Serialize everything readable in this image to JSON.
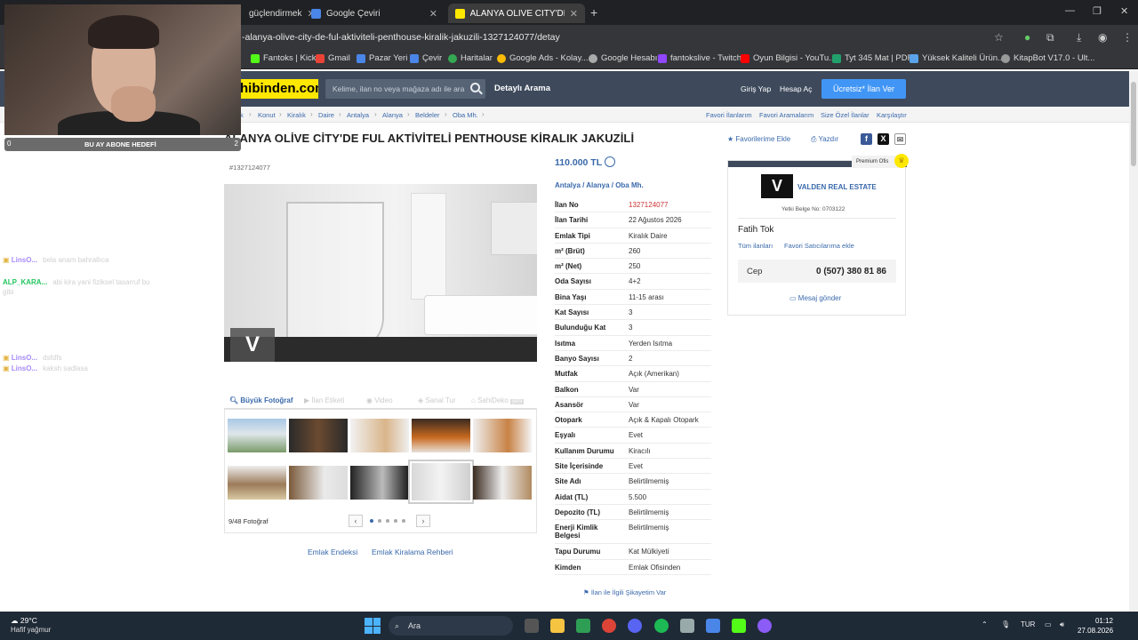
{
  "browser": {
    "tabs": [
      {
        "label": "güçlendirmek",
        "active": false
      },
      {
        "label": "Google Çeviri",
        "active": false
      },
      {
        "label": "ALANYA OLİVE CİTY'DE FUL AK",
        "active": true
      }
    ],
    "url": "-alanya-olive-city-de-ful-aktiviteli-penthouse-kiralik-jakuzili-1327124077/detay",
    "bookmarks": [
      "Fantoks | Kick",
      "Gmail",
      "Pazar Yeri",
      "Çevir",
      "Haritalar",
      "Google Ads - Kolay...",
      "Google Hesabı",
      "fantokslive - Twitch",
      "Oyun Bilgisi - YouTu...",
      "Tyt 345 Mat | PDF",
      "Yüksek Kaliteli Ürün...",
      "KitapBot V17.0 - Ult..."
    ]
  },
  "header": {
    "logo": "hibinden.com",
    "search_placeholder": "Kelime, ilan no veya mağaza adı ile ara",
    "detail_search": "Detaylı Arama",
    "login": "Giriş Yap",
    "register": "Hesap Aç",
    "cta": "Ücretsiz* İlan Ver"
  },
  "breadcrumb": {
    "items": [
      "k",
      "Konut",
      "Kiralık",
      "Daire",
      "Antalya",
      "Alanya",
      "Beldeler",
      "Oba Mh."
    ],
    "right": [
      "Favori İlanlarım",
      "Favori Aramalarım",
      "Size Özel İlanlar",
      "Karşılaştır"
    ]
  },
  "listing": {
    "title": "ALANYA OLİVE CİTY'DE FUL AKTİVİTELİ PENTHOUSE KİRALIK JAKUZİLİ",
    "fav_add": "Favorilerime Ekle",
    "print": "Yazdır",
    "id_tag": "#1327124077",
    "price": "110.000 TL",
    "location": [
      "Antalya",
      "Alanya",
      "Oba Mh."
    ],
    "details": [
      {
        "k": "İlan No",
        "v": "1327124077"
      },
      {
        "k": "İlan Tarihi",
        "v": "22 Ağustos 2026"
      },
      {
        "k": "Emlak Tipi",
        "v": "Kiralık Daire"
      },
      {
        "k": "m² (Brüt)",
        "v": "260"
      },
      {
        "k": "m² (Net)",
        "v": "250"
      },
      {
        "k": "Oda Sayısı",
        "v": "4+2"
      },
      {
        "k": "Bina Yaşı",
        "v": "11-15 arası"
      },
      {
        "k": "Kat Sayısı",
        "v": "3"
      },
      {
        "k": "Bulunduğu Kat",
        "v": "3"
      },
      {
        "k": "Isıtma",
        "v": "Yerden Isıtma"
      },
      {
        "k": "Banyo Sayısı",
        "v": "2"
      },
      {
        "k": "Mutfak",
        "v": "Açık (Amerikan)"
      },
      {
        "k": "Balkon",
        "v": "Var"
      },
      {
        "k": "Asansör",
        "v": "Var"
      },
      {
        "k": "Otopark",
        "v": "Açık & Kapalı Otopark"
      },
      {
        "k": "Eşyalı",
        "v": "Evet"
      },
      {
        "k": "Kullanım Durumu",
        "v": "Kiracılı"
      },
      {
        "k": "Site İçerisinde",
        "v": "Evet"
      },
      {
        "k": "Site Adı",
        "v": "Belirtilmemiş"
      },
      {
        "k": "Aidat (TL)",
        "v": "5.500"
      },
      {
        "k": "Depozito (TL)",
        "v": "Belirtilmemiş"
      },
      {
        "k": "Enerji Kimlik Belgesi",
        "v": "Belirtilmemiş"
      },
      {
        "k": "Tapu Durumu",
        "v": "Kat Mülkiyeti"
      },
      {
        "k": "Kimden",
        "v": "Emlak Ofisinden"
      }
    ],
    "complaint": "İlan ile İlgili Şikayetim Var"
  },
  "gallery": {
    "tabs": [
      "Büyük Fotoğraf",
      "İlan Etiketi",
      "Video",
      "Sanal Tur",
      "SahiDeko"
    ],
    "sahideko_badge": "yeni",
    "counter": "9/48 Fotoğraf",
    "watermark": "V",
    "links": [
      "Emlak Endeksi",
      "Emlak Kiralama Rehberi"
    ]
  },
  "seller": {
    "premium": "Premium Ofis",
    "logo": "V",
    "name": "VALDEN REAL ESTATE",
    "license": "Yetki Belge No:  0703122",
    "agent": "Fatih Tok",
    "links": [
      "Tüm ilanları",
      "Favori Satıcılarıma ekle"
    ],
    "phone_label": "Cep",
    "phone": "0 (507) 380 81 86",
    "message": "Mesaj gönder"
  },
  "overlay": {
    "sub_left": "0",
    "sub_text": "BU AY ABONE HEDEFİ",
    "sub_right": "2",
    "chat": [
      {
        "user": "LinsO...",
        "msg": "bela anam bahrallıca",
        "color": "#a78bfa"
      },
      {
        "user": "ALP_KARA...",
        "msg": "abi kira yani fiziksel tasarruf bu gibi",
        "color": "#22c55e"
      },
      {
        "user": "LinsO...",
        "msg": "dsfdfs",
        "color": "#a78bfa"
      },
      {
        "user": "LinsO...",
        "msg": "kaksh sadlasa",
        "color": "#a78bfa"
      }
    ]
  },
  "taskbar": {
    "temp": "29°C",
    "weather": "Hafif yağmur",
    "search": "Ara",
    "lang": "TUR",
    "time": "01:12",
    "date": "27.08.2026"
  }
}
